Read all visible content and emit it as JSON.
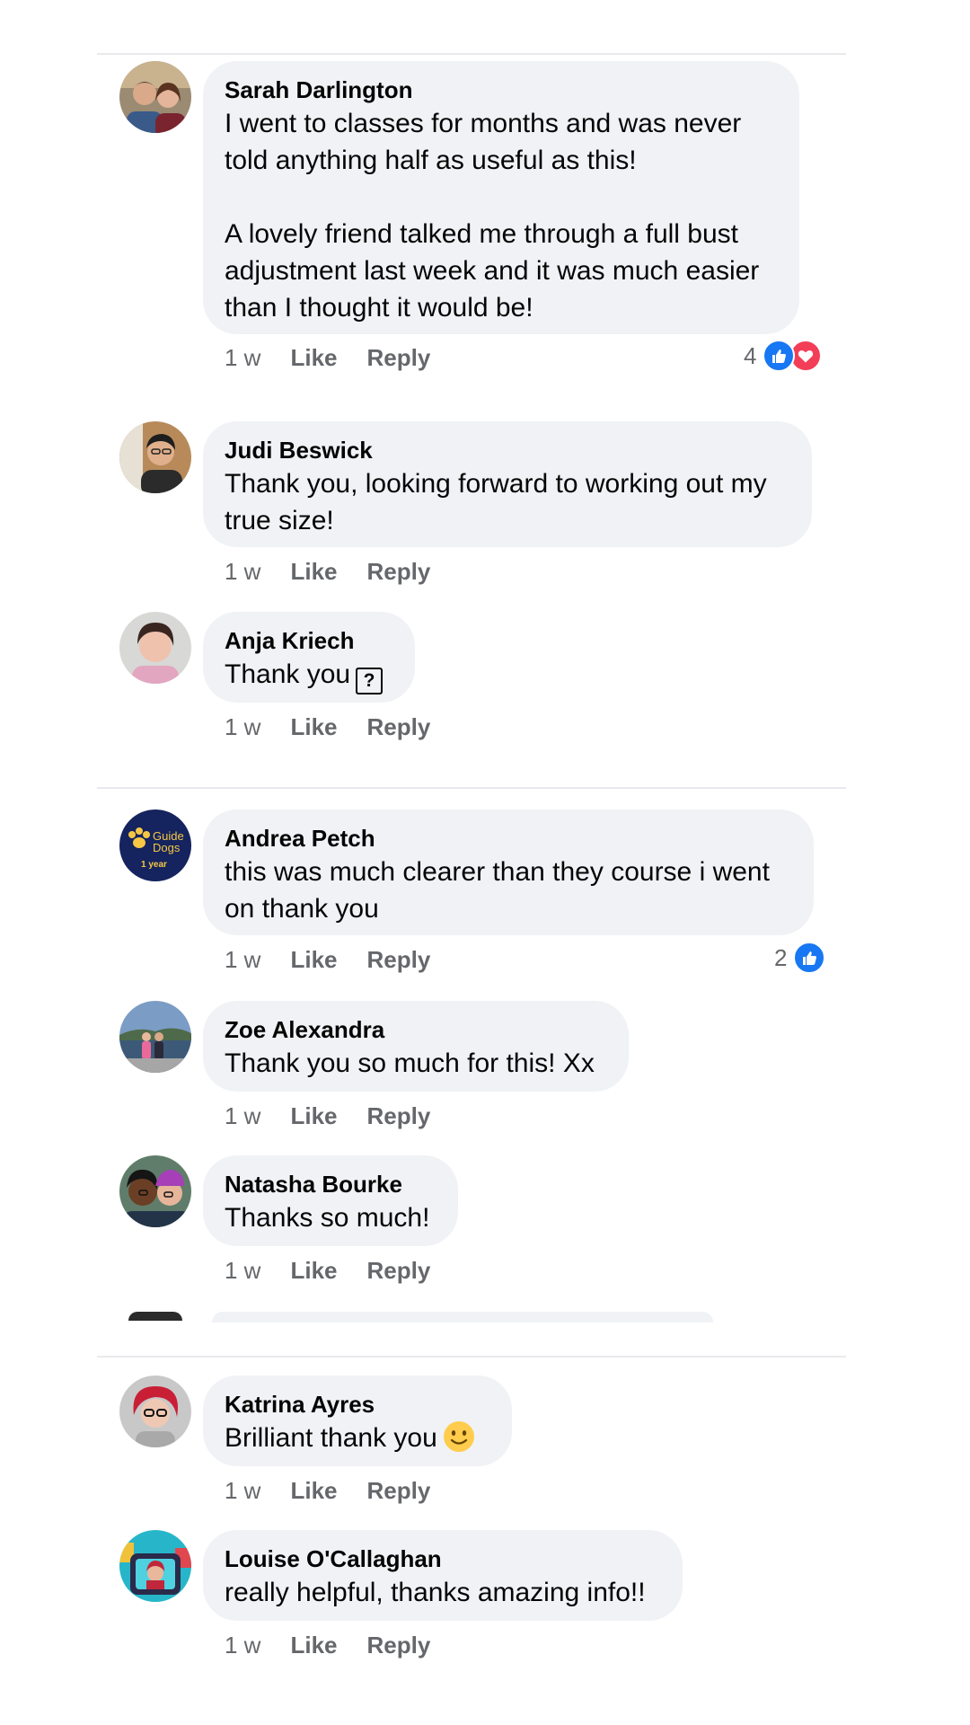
{
  "comments": [
    {
      "author": "Sarah Darlington",
      "text": "I went to classes for months and was never\ntold anything half as useful as this!\n\nA lovely friend talked me through a full bust\nadjustment last week and it was much easier\nthan I thought it would be!",
      "time": "1 w",
      "like": "Like",
      "reply": "Reply",
      "reactions": {
        "count": "4",
        "types": [
          "like-icon",
          "love-icon"
        ]
      }
    },
    {
      "author": "Judi Beswick",
      "text": "Thank you, looking forward to working out my\ntrue size!",
      "time": "1 w",
      "like": "Like",
      "reply": "Reply"
    },
    {
      "author": "Anja Kriech",
      "text": "Thank you",
      "glyph": "?",
      "time": "1 w",
      "like": "Like",
      "reply": "Reply"
    },
    {
      "author": "Andrea Petch",
      "text": "this was much clearer than they course i went\non thank you",
      "time": "1 w",
      "like": "Like",
      "reply": "Reply",
      "reactions": {
        "count": "2",
        "types": [
          "like-icon"
        ]
      },
      "avatar_text": {
        "line1": "Guide",
        "line2": "Dogs",
        "line3": "1 year"
      }
    },
    {
      "author": "Zoe Alexandra",
      "text": "Thank you so much for this! Xx",
      "time": "1 w",
      "like": "Like",
      "reply": "Reply"
    },
    {
      "author": "Natasha Bourke",
      "text": "Thanks so much!",
      "time": "1 w",
      "like": "Like",
      "reply": "Reply"
    },
    {
      "author": "Katrina Ayres",
      "text": "Brilliant thank you",
      "emoji": "slightly-smiling-face-icon",
      "time": "1 w",
      "like": "Like",
      "reply": "Reply"
    },
    {
      "author": "Louise O'Callaghan",
      "text": "really helpful, thanks amazing info!!",
      "time": "1 w",
      "like": "Like",
      "reply": "Reply"
    }
  ],
  "colors": {
    "bubble": "#f0f2f5",
    "secondary_text": "#65676b",
    "like_blue": "#1877f2",
    "love_red": "#f33e58"
  }
}
